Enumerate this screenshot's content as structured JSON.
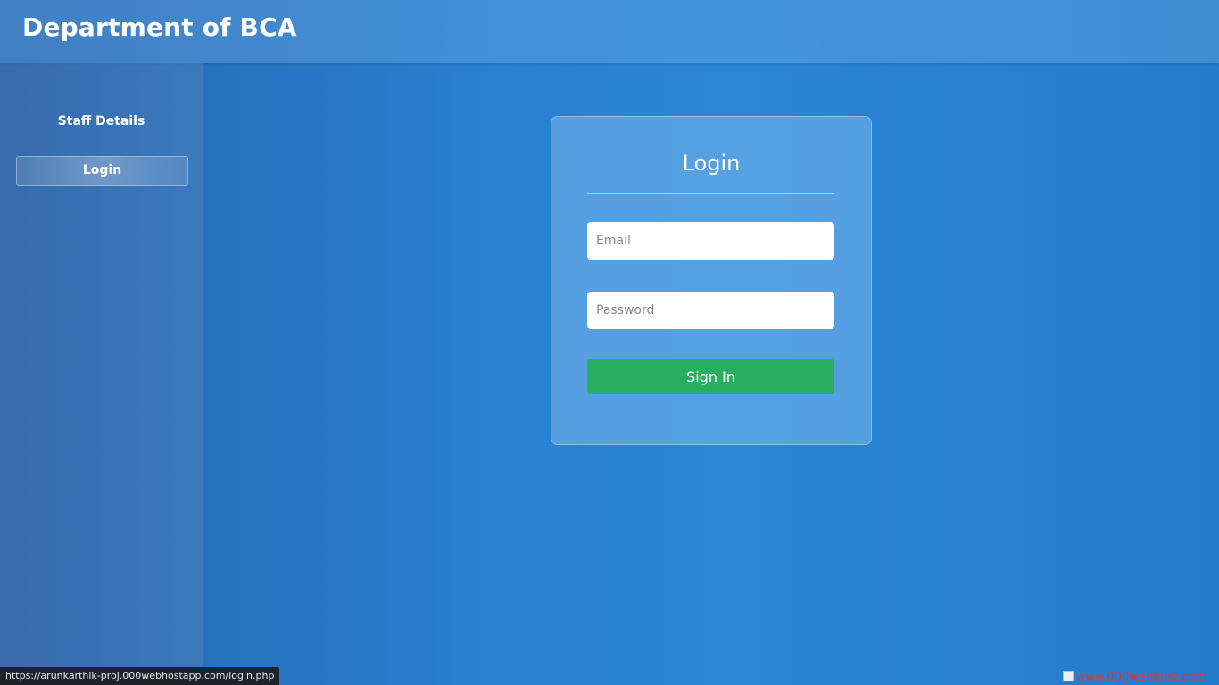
{
  "header": {
    "title": "Department of BCA"
  },
  "sidebar": {
    "items": [
      {
        "label": "Staff Details"
      },
      {
        "label": "Login",
        "active": true
      }
    ]
  },
  "login_card": {
    "title": "Login",
    "email": {
      "placeholder": "Email",
      "value": ""
    },
    "password": {
      "placeholder": "Password",
      "value": ""
    },
    "submit_label": "Sign In"
  },
  "status_bar": {
    "url": "https://arunkarthik-proj.000webhostapp.com/login.php"
  },
  "host_badge": {
    "text": "www.000webhost.com",
    "icon": "broken-image-icon"
  },
  "colors": {
    "accent_button": "#27ae60",
    "background": "#2a82d4"
  }
}
